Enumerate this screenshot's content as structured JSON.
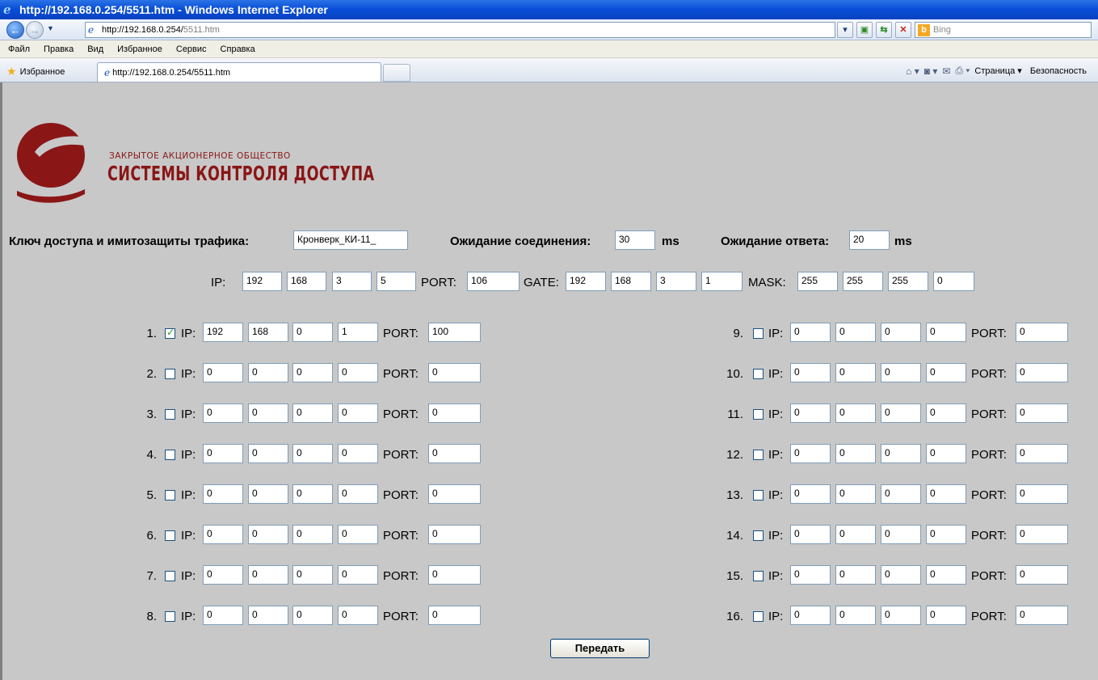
{
  "window": {
    "title": "http://192.168.0.254/5511.htm - Windows Internet Explorer",
    "url_host": "http://192.168.0.254/",
    "url_path": "5511.htm",
    "search_placeholder": "Bing",
    "menu": [
      "Файл",
      "Правка",
      "Вид",
      "Избранное",
      "Сервис",
      "Справка"
    ],
    "favorites_label": "Избранное",
    "tab_title": "http://192.168.0.254/5511.htm",
    "page_menu": "Страница ▾",
    "safety_menu": "Безопасность"
  },
  "logo": {
    "line1": "ЗАКРЫТОЕ  АКЦИОНЕРНОЕ  ОБЩЕСТВО",
    "line2": "СИСТЕМЫ КОНТРОЛЯ ДОСТУПА",
    "color": "#8a1616"
  },
  "settings": {
    "key_label": "Ключ доступа и имитозащиты трафика:",
    "key_value": "Кронверк_КИ-11_",
    "conn_wait_label": "Ожидание соединения:",
    "conn_wait_value": "30",
    "conn_wait_unit": "ms",
    "resp_wait_label": "Ожидание ответа:",
    "resp_wait_value": "20",
    "resp_wait_unit": "ms"
  },
  "network": {
    "ip_label": "IP:",
    "ip": [
      "192",
      "168",
      "3",
      "5"
    ],
    "port_label": "PORT:",
    "port": "106",
    "gate_label": "GATE:",
    "gate": [
      "192",
      "168",
      "3",
      "1"
    ],
    "mask_label": "MASK:",
    "mask": [
      "255",
      "255",
      "255",
      "0"
    ]
  },
  "clients": {
    "ip_label": "IP:",
    "port_label": "PORT:",
    "rows": [
      {
        "num": "1.",
        "checked": true,
        "ip": [
          "192",
          "168",
          "0",
          "1"
        ],
        "port": "100"
      },
      {
        "num": "2.",
        "checked": false,
        "ip": [
          "0",
          "0",
          "0",
          "0"
        ],
        "port": "0"
      },
      {
        "num": "3.",
        "checked": false,
        "ip": [
          "0",
          "0",
          "0",
          "0"
        ],
        "port": "0"
      },
      {
        "num": "4.",
        "checked": false,
        "ip": [
          "0",
          "0",
          "0",
          "0"
        ],
        "port": "0"
      },
      {
        "num": "5.",
        "checked": false,
        "ip": [
          "0",
          "0",
          "0",
          "0"
        ],
        "port": "0"
      },
      {
        "num": "6.",
        "checked": false,
        "ip": [
          "0",
          "0",
          "0",
          "0"
        ],
        "port": "0"
      },
      {
        "num": "7.",
        "checked": false,
        "ip": [
          "0",
          "0",
          "0",
          "0"
        ],
        "port": "0"
      },
      {
        "num": "8.",
        "checked": false,
        "ip": [
          "0",
          "0",
          "0",
          "0"
        ],
        "port": "0"
      },
      {
        "num": "9.",
        "checked": false,
        "ip": [
          "0",
          "0",
          "0",
          "0"
        ],
        "port": "0"
      },
      {
        "num": "10.",
        "checked": false,
        "ip": [
          "0",
          "0",
          "0",
          "0"
        ],
        "port": "0"
      },
      {
        "num": "11.",
        "checked": false,
        "ip": [
          "0",
          "0",
          "0",
          "0"
        ],
        "port": "0"
      },
      {
        "num": "12.",
        "checked": false,
        "ip": [
          "0",
          "0",
          "0",
          "0"
        ],
        "port": "0"
      },
      {
        "num": "13.",
        "checked": false,
        "ip": [
          "0",
          "0",
          "0",
          "0"
        ],
        "port": "0"
      },
      {
        "num": "14.",
        "checked": false,
        "ip": [
          "0",
          "0",
          "0",
          "0"
        ],
        "port": "0"
      },
      {
        "num": "15.",
        "checked": false,
        "ip": [
          "0",
          "0",
          "0",
          "0"
        ],
        "port": "0"
      },
      {
        "num": "16.",
        "checked": false,
        "ip": [
          "0",
          "0",
          "0",
          "0"
        ],
        "port": "0"
      }
    ]
  },
  "submit_label": "Передать"
}
